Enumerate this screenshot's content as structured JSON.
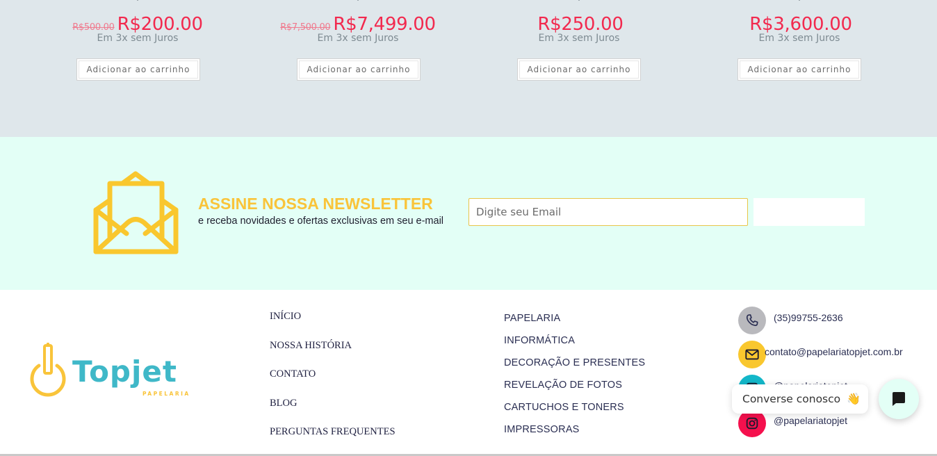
{
  "products": [
    {
      "old_price": "R$500.00",
      "price": "R$200.00",
      "installments": "Em 3x sem Juros",
      "button": "Adicionar ao carrinho"
    },
    {
      "old_price": "R$7,500.00",
      "price": "R$7,499.00",
      "installments": "Em 3x sem Juros",
      "button": "Adicionar ao carrinho"
    },
    {
      "old_price": "",
      "price": "R$250.00",
      "installments": "Em 3x sem Juros",
      "button": "Adicionar ao carrinho"
    },
    {
      "old_price": "",
      "price": "R$3,600.00",
      "installments": "Em 3x sem Juros",
      "button": "Adicionar ao carrinho"
    }
  ],
  "newsletter": {
    "title": "ASSINE NOSSA NEWSLETTER",
    "subtitle": "e receba novidades e ofertas exclusivas em seu e-mail",
    "email_placeholder": "Digite seu Email",
    "email_value": "",
    "submit_label": "",
    "icon": "envelope-open-icon"
  },
  "footer": {
    "logo": {
      "brand": "Topjet",
      "tagline": "PAPELARIA"
    },
    "nav_main": [
      "INÍCIO",
      "NOSSA HISTÓRIA",
      "CONTATO",
      "BLOG",
      "PERGUNTAS FREQUENTES"
    ],
    "nav_categories": [
      "PAPELARIA",
      "INFORMÁTICA",
      "DECORAÇÃO E PRESENTES",
      "REVELAÇÃO DE FOTOS",
      "CARTUCHOS E TONERS",
      "IMPRESSORAS"
    ],
    "contacts": {
      "phone": "(35)99755-2636",
      "email": "contato@papelariatopjet.com.br",
      "facebook": "@papelariatopjet",
      "instagram": "@papelariatopjet"
    }
  },
  "chat": {
    "label": "Converse conosco",
    "emoji": "👋"
  },
  "colors": {
    "products_bg": "#dfe7eb",
    "newsletter_bg": "#e3fff6",
    "accent_yellow": "#f9c43a",
    "price_red": "#f2294e",
    "instagram": "#f5104d",
    "social_teal": "#13b7c9"
  }
}
